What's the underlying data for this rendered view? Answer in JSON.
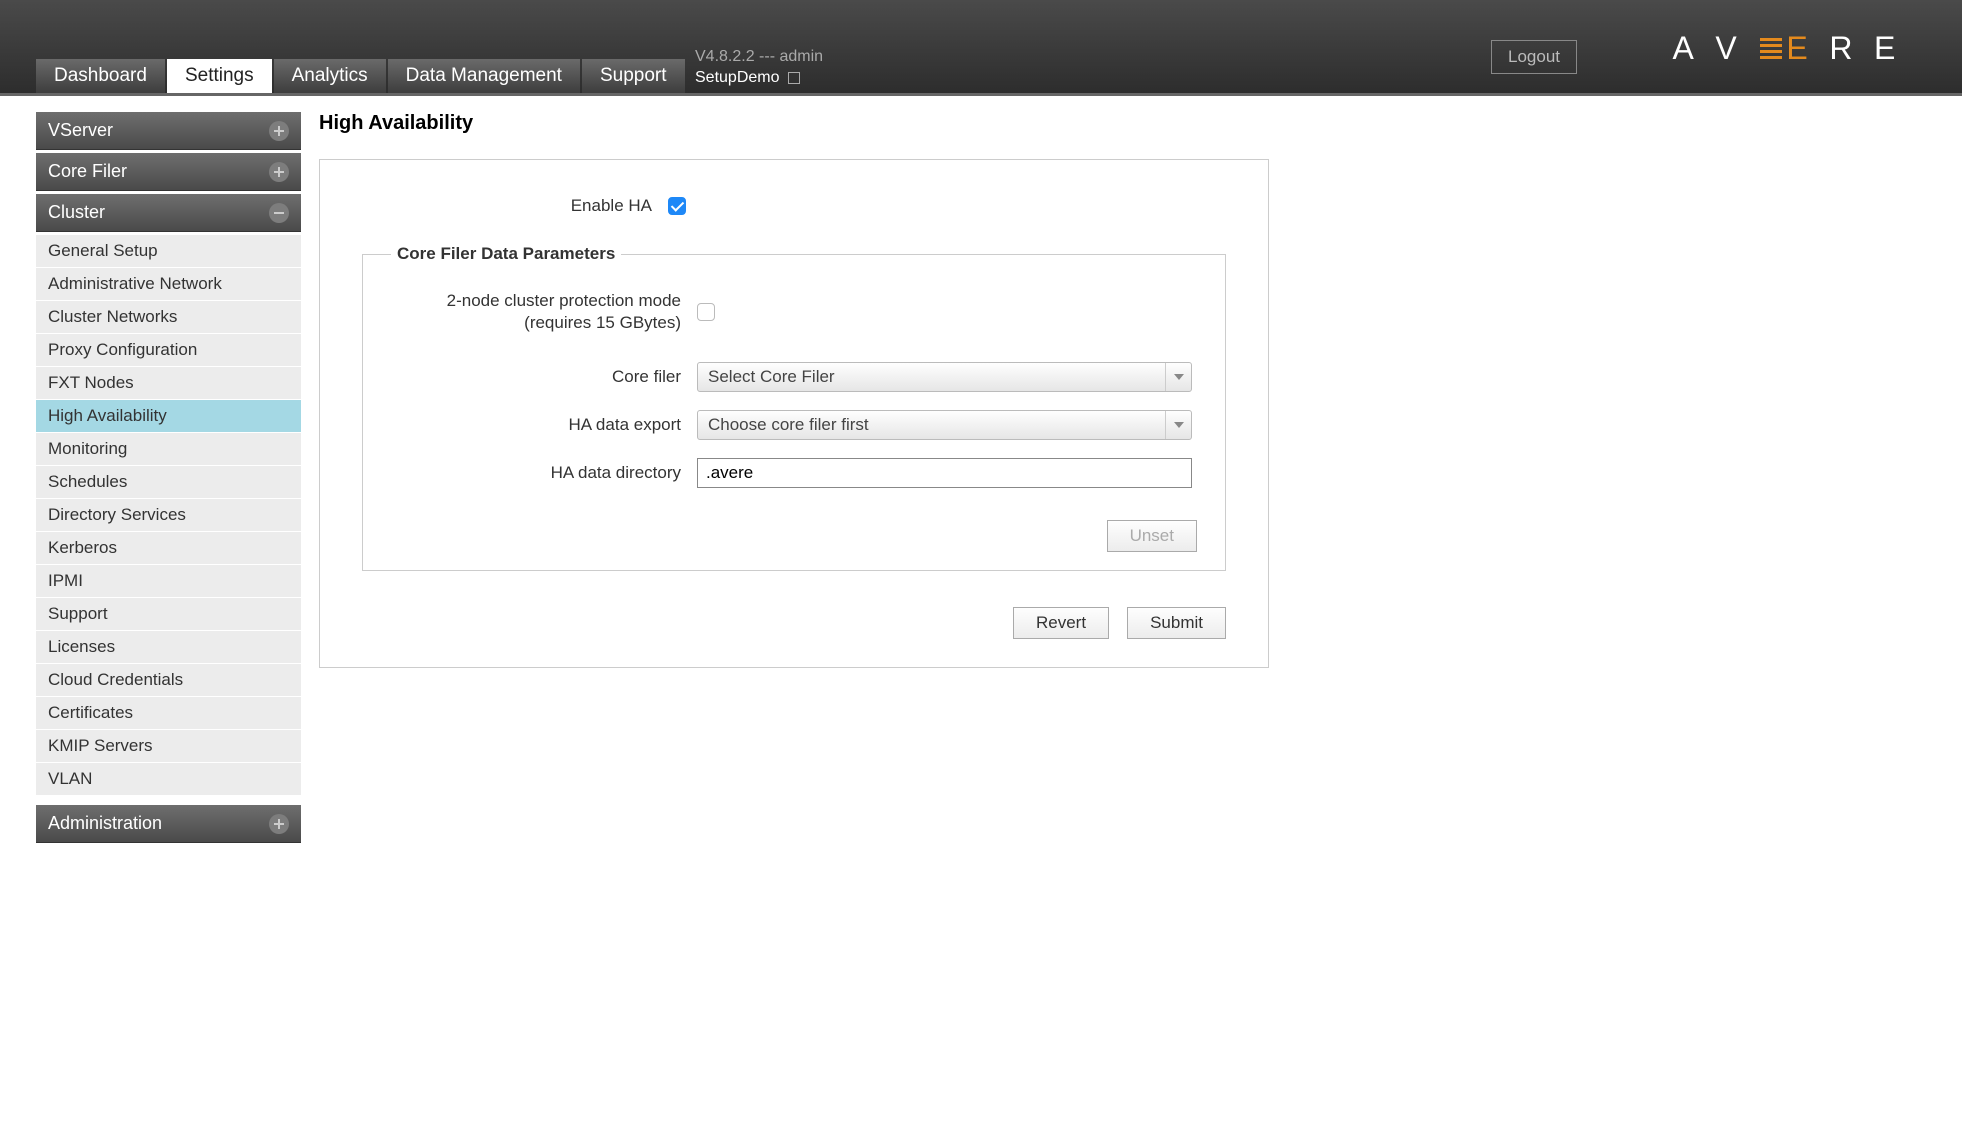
{
  "header": {
    "logout": "Logout",
    "version_line": "V4.8.2.2 --- admin",
    "cluster_name": "SetupDemo",
    "logo_letters": [
      "A",
      "V",
      "E",
      "R",
      "E"
    ],
    "tabs": [
      {
        "id": "dashboard",
        "label": "Dashboard"
      },
      {
        "id": "settings",
        "label": "Settings",
        "active": true
      },
      {
        "id": "analytics",
        "label": "Analytics"
      },
      {
        "id": "datamgmt",
        "label": "Data Management"
      },
      {
        "id": "support",
        "label": "Support"
      }
    ]
  },
  "sidebar": {
    "sections": [
      {
        "id": "vserver",
        "label": "VServer",
        "expanded": false
      },
      {
        "id": "corefiler",
        "label": "Core Filer",
        "expanded": false
      },
      {
        "id": "cluster",
        "label": "Cluster",
        "expanded": true,
        "items": [
          {
            "id": "general-setup",
            "label": "General Setup"
          },
          {
            "id": "administrative-network",
            "label": "Administrative Network"
          },
          {
            "id": "cluster-networks",
            "label": "Cluster Networks"
          },
          {
            "id": "proxy-configuration",
            "label": "Proxy Configuration"
          },
          {
            "id": "fxt-nodes",
            "label": "FXT Nodes"
          },
          {
            "id": "high-availability",
            "label": "High Availability",
            "active": true
          },
          {
            "id": "monitoring",
            "label": "Monitoring"
          },
          {
            "id": "schedules",
            "label": "Schedules"
          },
          {
            "id": "directory-services",
            "label": "Directory Services"
          },
          {
            "id": "kerberos",
            "label": "Kerberos"
          },
          {
            "id": "ipmi",
            "label": "IPMI"
          },
          {
            "id": "support",
            "label": "Support"
          },
          {
            "id": "licenses",
            "label": "Licenses"
          },
          {
            "id": "cloud-credentials",
            "label": "Cloud Credentials"
          },
          {
            "id": "certificates",
            "label": "Certificates"
          },
          {
            "id": "kmip-servers",
            "label": "KMIP Servers"
          },
          {
            "id": "vlan",
            "label": "VLAN"
          }
        ]
      },
      {
        "id": "administration",
        "label": "Administration",
        "expanded": false
      }
    ]
  },
  "page": {
    "title": "High Availability",
    "enable_ha_label": "Enable HA",
    "enable_ha_checked": true,
    "fieldset_legend": "Core Filer Data Parameters",
    "two_node_label": "2-node cluster protection mode (requires 15 GBytes)",
    "two_node_checked": false,
    "core_filer_label": "Core filer",
    "core_filer_value": "Select Core Filer",
    "ha_export_label": "HA data export",
    "ha_export_value": "Choose core filer first",
    "ha_dir_label": "HA data directory",
    "ha_dir_value": ".avere",
    "unset_label": "Unset",
    "revert_label": "Revert",
    "submit_label": "Submit"
  }
}
